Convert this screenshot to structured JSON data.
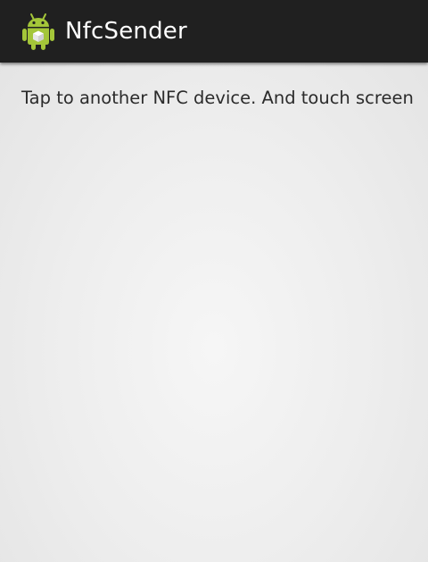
{
  "action_bar": {
    "title": "NfcSender",
    "icon": "android-robot-icon"
  },
  "main": {
    "message": "Tap to another NFC device. And touch screen"
  },
  "colors": {
    "action_bar_bg": "#202020",
    "title_text": "#ffffff",
    "body_text": "#2b2b2b",
    "android_green": "#a4c639"
  }
}
